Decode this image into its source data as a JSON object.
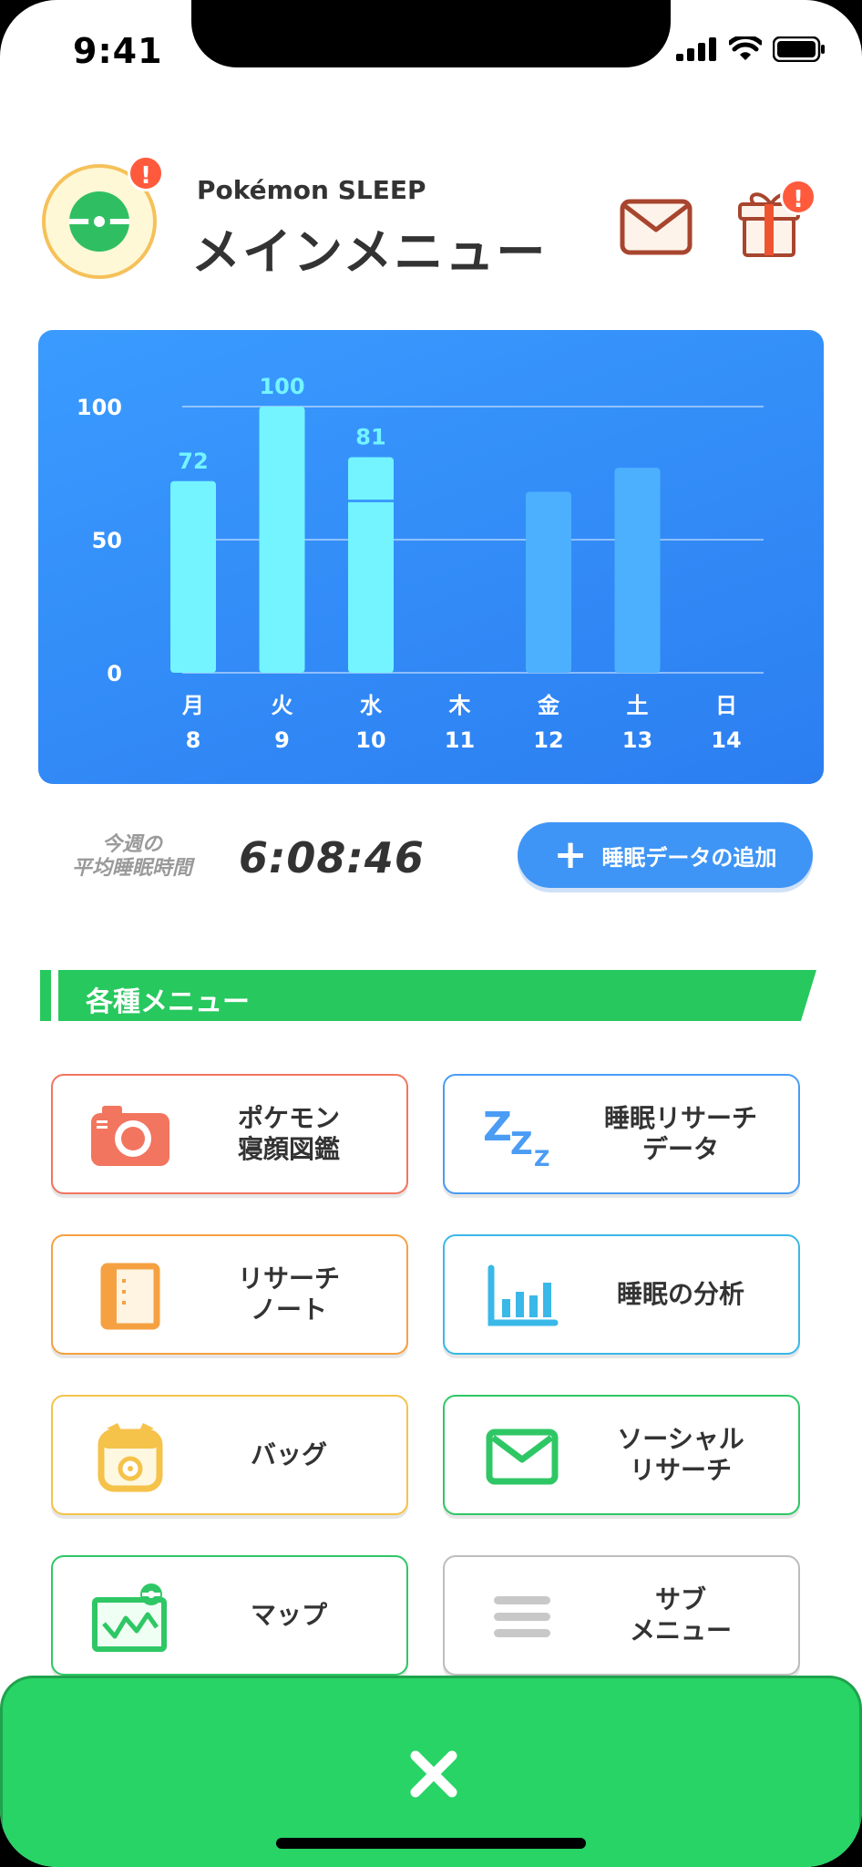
{
  "status_bar": {
    "time": "9:41"
  },
  "header": {
    "subtitle": "Pokémon SLEEP",
    "title": "メインメニュー",
    "badge": "!"
  },
  "chart_data": {
    "type": "bar",
    "categories": [
      "月",
      "火",
      "水",
      "木",
      "金",
      "土",
      "日"
    ],
    "dates": [
      "8",
      "9",
      "10",
      "11",
      "12",
      "13",
      "14"
    ],
    "values": [
      72,
      100,
      81,
      null,
      68,
      77,
      null
    ],
    "data_labels": [
      "72",
      "100",
      "81",
      "",
      "",
      "",
      ""
    ],
    "yticks": [
      "0",
      "50",
      "100"
    ],
    "ylim": [
      0,
      100
    ],
    "grid": true,
    "colors": {
      "active": "#73f4ff",
      "inactive": "#4cb0ff"
    }
  },
  "summary": {
    "label_line1": "今週の",
    "label_line2": "平均睡眠時間",
    "value": "6:08:46",
    "add_button": "睡眠データの追加"
  },
  "menu_section": {
    "title": "各種メニュー",
    "items": [
      {
        "label": "ポケモン\n寝顔図鑑",
        "icon": "camera-icon",
        "color": "#f2755f"
      },
      {
        "label": "睡眠リサーチ\nデータ",
        "icon": "zzz-icon",
        "color": "#4a9cf5"
      },
      {
        "label": "リサーチ\nノート",
        "icon": "notebook-icon",
        "color": "#f5a142"
      },
      {
        "label": "睡眠の分析",
        "icon": "bar-chart-icon",
        "color": "#3ab8e8"
      },
      {
        "label": "バッグ",
        "icon": "bag-icon",
        "color": "#f5c24a"
      },
      {
        "label": "ソーシャル\nリサーチ",
        "icon": "mail-icon",
        "color": "#2fc765"
      },
      {
        "label": "マップ",
        "icon": "map-icon",
        "color": "#2fc765"
      },
      {
        "label": "サブ\nメニュー",
        "icon": "hamburger-icon",
        "color": "#bdbdbd"
      }
    ]
  },
  "bottom_bar": {
    "close_symbol": "✕"
  }
}
